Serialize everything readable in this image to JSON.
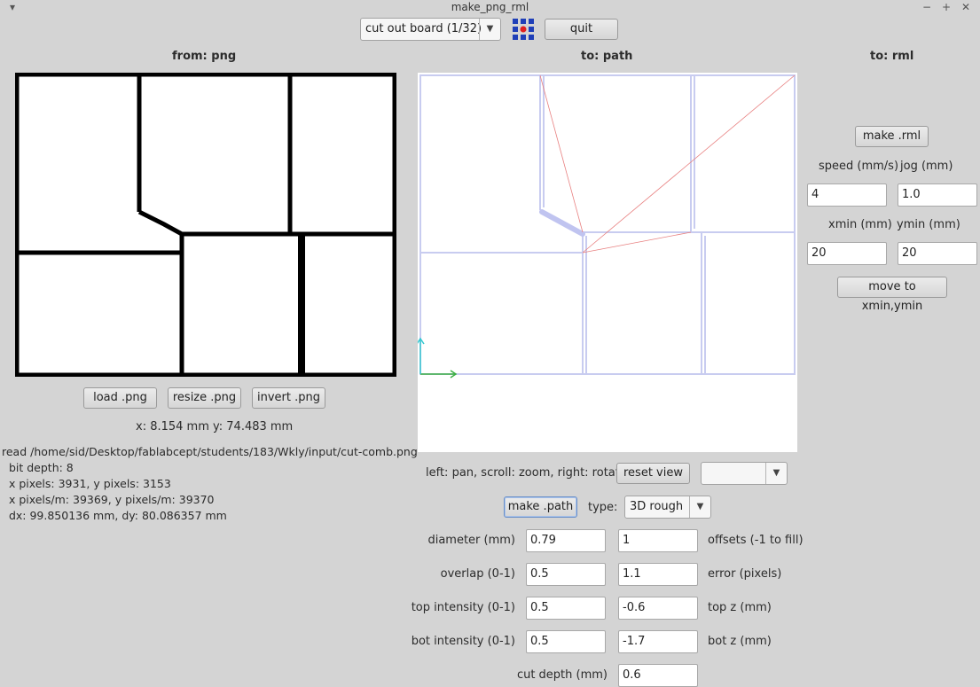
{
  "window": {
    "title": "make_png_rml",
    "menu_icon": "chevron-down-icon",
    "controls": [
      "minimize-icon",
      "maximize-icon",
      "close-icon"
    ]
  },
  "toolbar": {
    "mode_select": "cut out board (1/32)",
    "logo_icon": "fab-grid-logo-icon",
    "quit_label": "quit"
  },
  "from_png": {
    "header": "from: png",
    "load_label": "load .png",
    "resize_label": "resize .png",
    "invert_label": "invert .png",
    "coords": "x: 8.154 mm  y: 74.483 mm",
    "info": [
      "read /home/sid/Desktop/fablabcept/students/183/Wkly/input/cut-comb.png",
      "  bit depth: 8",
      "  x pixels: 3931, y pixels: 3153",
      "  x pixels/m: 39369, y pixels/m: 39370",
      "  dx: 99.850136 mm, dy: 80.086357 mm"
    ]
  },
  "to_path": {
    "header": "to: path",
    "hint": "left: pan, scroll: zoom, right: rotate",
    "reset_label": "reset view",
    "view_select": "",
    "make_label": "make .path",
    "type_label": "type:",
    "type_value": "3D rough",
    "params": [
      {
        "left_label": "diameter (mm)",
        "left_value": "0.79",
        "right_value": "1",
        "right_label": "offsets (-1 to fill)"
      },
      {
        "left_label": "overlap (0-1)",
        "left_value": "0.5",
        "right_value": "1.1",
        "right_label": "error (pixels)"
      },
      {
        "left_label": "top intensity (0-1)",
        "left_value": "0.5",
        "right_value": "-0.6",
        "right_label": "top z (mm)"
      },
      {
        "left_label": "bot intensity (0-1)",
        "left_value": "0.5",
        "right_value": "-1.7",
        "right_label": "bot z (mm)"
      }
    ],
    "cut_depth_label": "cut depth (mm)",
    "cut_depth_value": "0.6"
  },
  "to_rml": {
    "header": "to: rml",
    "make_label": "make .rml",
    "speed_label": "speed (mm/s)",
    "jog_label": "jog (mm)",
    "speed_value": "4",
    "jog_value": "1.0",
    "xmin_label": "xmin (mm)",
    "ymin_label": "ymin (mm)",
    "xmin_value": "20",
    "ymin_value": "20",
    "move_label": "move to xmin,ymin"
  },
  "colors": {
    "background": "#d4d4d4",
    "path_lines": "#c8ccf0",
    "travel_lines": "#e88080",
    "axis_x": "#3cb043",
    "axis_y": "#35c8d0"
  }
}
